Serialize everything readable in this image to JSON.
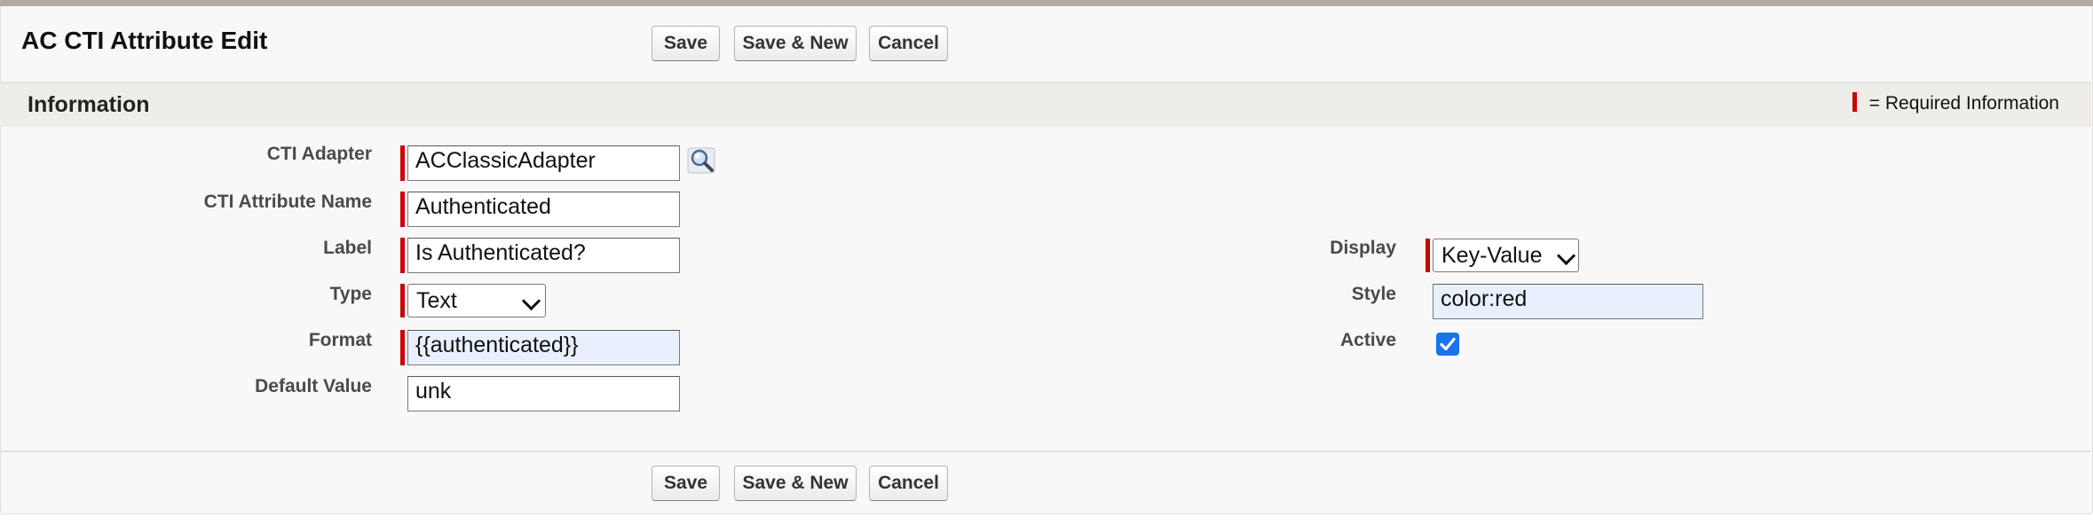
{
  "page": {
    "title": "AC CTI Attribute Edit"
  },
  "buttons": {
    "save": "Save",
    "save_new": "Save & New",
    "cancel": "Cancel"
  },
  "section": {
    "title": "Information",
    "required_legend": "= Required Information"
  },
  "fields": {
    "cti_adapter": {
      "label": "CTI Adapter",
      "value": "ACClassicAdapter",
      "required": true
    },
    "cti_attribute_name": {
      "label": "CTI Attribute Name",
      "value": "Authenticated",
      "required": true
    },
    "label": {
      "label": "Label",
      "value": "Is Authenticated?",
      "required": true
    },
    "type": {
      "label": "Type",
      "value": "Text",
      "required": true
    },
    "format": {
      "label": "Format",
      "value": "{{authenticated}}",
      "required": true
    },
    "default_value": {
      "label": "Default Value",
      "value": "unk",
      "required": false
    },
    "display": {
      "label": "Display",
      "value": "Key-Value",
      "required": true
    },
    "style": {
      "label": "Style",
      "value": "color:red",
      "required": false
    },
    "active": {
      "label": "Active",
      "checked": true
    }
  },
  "icons": {
    "lookup": "magnifier-lookup-icon",
    "checkbox": "checkmark-icon"
  },
  "colors": {
    "required": "#cc0000",
    "checkbox": "#1a73e8",
    "section_bg": "#efede8"
  }
}
